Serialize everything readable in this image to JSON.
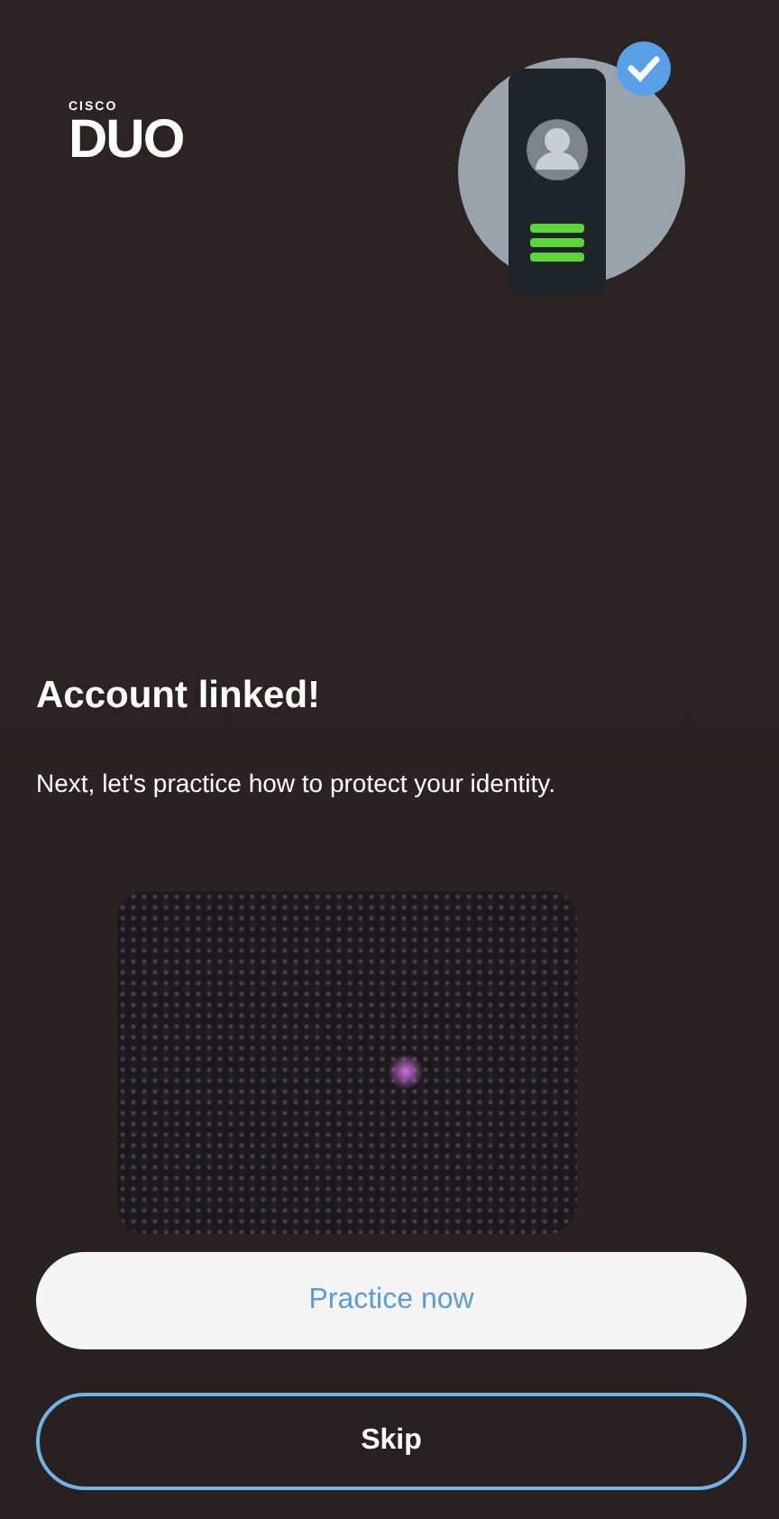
{
  "logo": {
    "small": "CISCO",
    "large": "DUO"
  },
  "heading": "Account linked!",
  "message": "Next, let's practice how to protect your identity.",
  "buttons": [
    {
      "label": "Practice now",
      "kind": "primary"
    },
    {
      "label": "Skip",
      "kind": "secondary"
    }
  ]
}
